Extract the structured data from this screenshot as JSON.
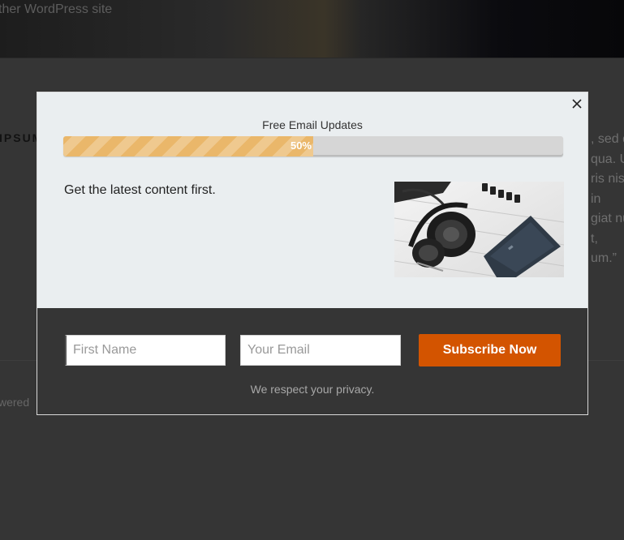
{
  "background": {
    "site_text": "ther WordPress site",
    "heading": "IPSUM",
    "right_lines": [
      ", sed d",
      "qua. U",
      "ris nis",
      "in",
      "giat nu",
      "t,",
      "um.”"
    ],
    "footer_text": "wered"
  },
  "popup": {
    "close_icon": "close-icon",
    "progress": {
      "title": "Free Email Updates",
      "percent": 50,
      "label": "50%",
      "color": "#eab76a"
    },
    "tagline": "Get the latest content first.",
    "image": "headphones-and-phone-photo",
    "form": {
      "first_name_placeholder": "First Name",
      "email_placeholder": "Your Email",
      "subscribe_label": "Subscribe Now",
      "button_color": "#d35400"
    },
    "privacy_text": "We respect your privacy."
  }
}
